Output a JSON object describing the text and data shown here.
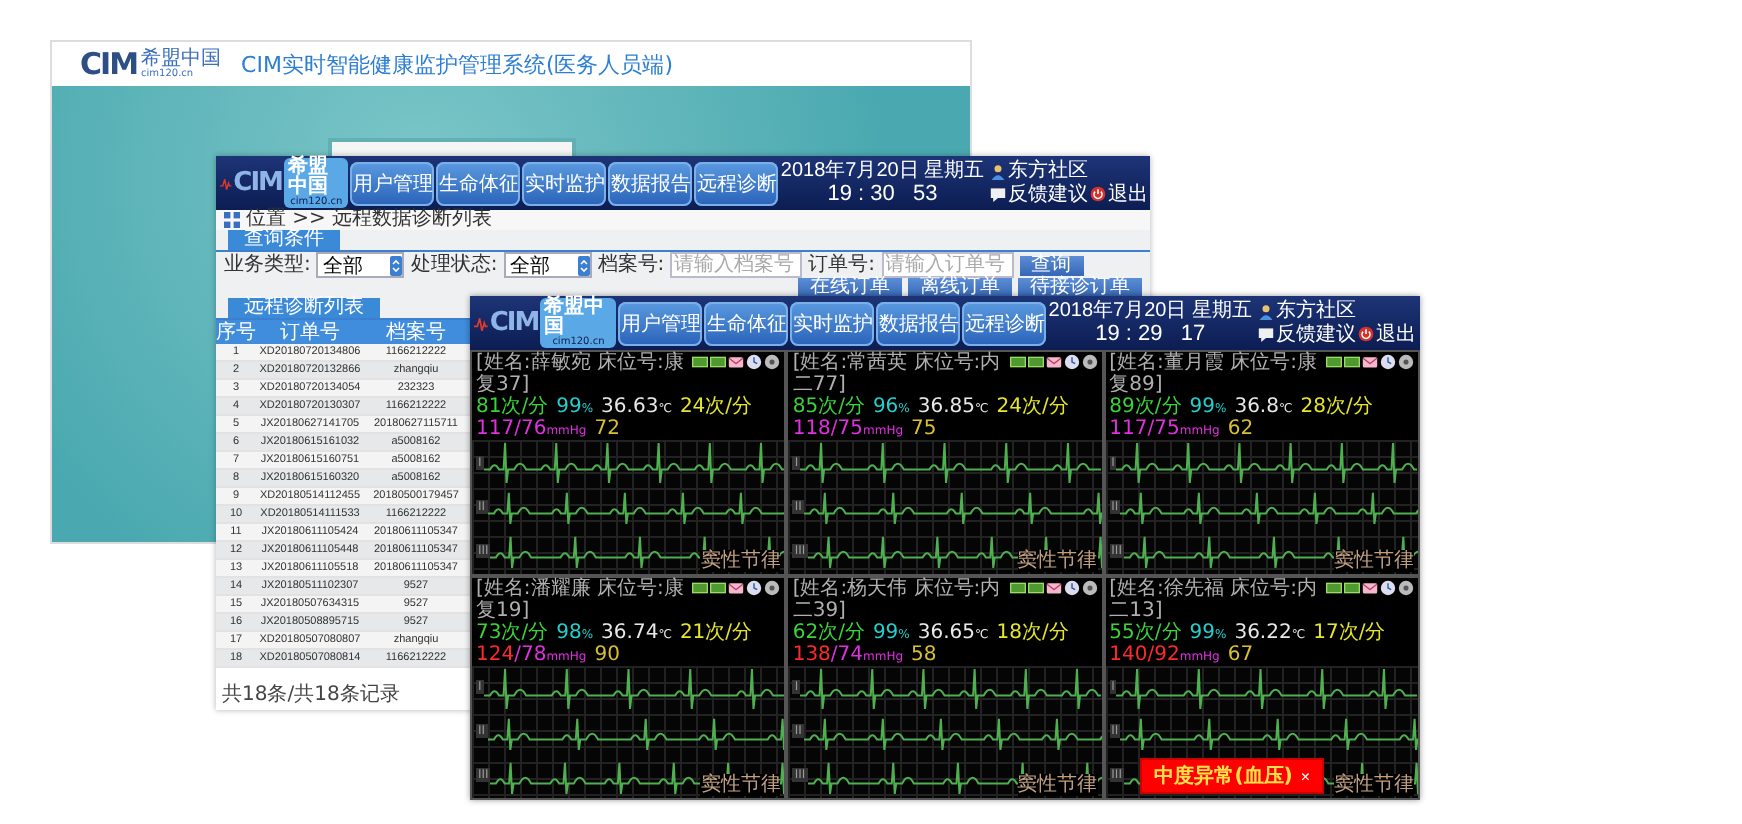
{
  "login_window": {
    "logo": {
      "mark": "CIM",
      "name": "希盟中国",
      "site": "cim120.cn"
    },
    "title": "CIM实时智能健康监护管理系统(医务人员端)"
  },
  "list_window": {
    "header": {
      "logo": {
        "mark": "CIM",
        "name": "希盟中国",
        "site": "cim120.cn"
      },
      "menu": [
        "用户管理",
        "生命体征",
        "实时监护",
        "数据报告",
        "远程诊断"
      ],
      "date": "2018年7月20日 星期五",
      "time": "19 : 30   53",
      "user": "东方社区",
      "feedback": "反馈建议",
      "logout": "退出"
    },
    "breadcrumb": "位置 >> 远程数据诊断列表",
    "filter_tab": "查询条件",
    "filters": [
      {
        "kind": "select",
        "label": "业务类型:",
        "value": "全部"
      },
      {
        "kind": "select",
        "label": "处理状态:",
        "value": "全部"
      },
      {
        "kind": "input",
        "label": "档案号:",
        "placeholder": "请输入档案号"
      },
      {
        "kind": "input",
        "label": "订单号:",
        "placeholder": "请输入订单号"
      }
    ],
    "search_button": "查询",
    "order_buttons": [
      "在线订单",
      "离线订单",
      "待接诊订单"
    ],
    "list_tab": "远程诊断列表",
    "table": {
      "columns": [
        "序号",
        "订单号",
        "档案号"
      ],
      "rows": [
        [
          "1",
          "XD20180720134806",
          "1166212222"
        ],
        [
          "2",
          "XD20180720132866",
          "zhangqiu"
        ],
        [
          "3",
          "XD20180720134054",
          "232323"
        ],
        [
          "4",
          "XD20180720130307",
          "1166212222"
        ],
        [
          "5",
          "JX20180627141705",
          "20180627115711"
        ],
        [
          "6",
          "JX20180615161032",
          "a5008162"
        ],
        [
          "7",
          "JX20180615160751",
          "a5008162"
        ],
        [
          "8",
          "JX20180615160320",
          "a5008162"
        ],
        [
          "9",
          "XD20180514112455",
          "20180500179457"
        ],
        [
          "10",
          "XD20180514111533",
          "1166212222"
        ],
        [
          "11",
          "JX20180611105424",
          "20180611105347"
        ],
        [
          "12",
          "JX20180611105448",
          "20180611105347"
        ],
        [
          "13",
          "JX20180611105518",
          "20180611105347"
        ],
        [
          "14",
          "JX20180511102307",
          "9527"
        ],
        [
          "15",
          "JX20180507634315",
          "9527"
        ],
        [
          "16",
          "JX20180508895715",
          "9527"
        ],
        [
          "17",
          "XD20180507080807",
          "zhangqiu"
        ],
        [
          "18",
          "XD20180507080814",
          "1166212222"
        ]
      ]
    },
    "footer": "共18条/共18条记录"
  },
  "monitor_window": {
    "header": {
      "logo": {
        "mark": "CIM",
        "name": "希盟中国",
        "site": "cim120.cn"
      },
      "menu": [
        "用户管理",
        "生命体征",
        "实时监护",
        "数据报告",
        "远程诊断"
      ],
      "date": "2018年7月20日 星期五",
      "time": "19 : 29   17",
      "user": "东方社区",
      "feedback": "反馈建议",
      "logout": "退出"
    },
    "panels": [
      {
        "patient": "[姓名:薛敏宛 床位号:康复37]",
        "vitals": [
          {
            "kind": "hr",
            "value": "81",
            "unit": "次/分"
          },
          {
            "kind": "spo2",
            "value": "99",
            "unit": "%"
          },
          {
            "kind": "temp",
            "value": "36.63",
            "unit": "℃"
          },
          {
            "kind": "resp",
            "value": "24",
            "unit": "次/分"
          },
          {
            "kind": "bp",
            "systolic": "117",
            "separator": "/",
            "diastolic": "76",
            "unit": "mmHg",
            "systolic_alarm": false,
            "diastolic_alarm": false
          },
          {
            "kind": "pr",
            "value": "72"
          }
        ],
        "leads": [
          "I",
          "II",
          "III"
        ],
        "rhythm": "窦性节律"
      },
      {
        "patient": "[姓名:常茜英 床位号:内二77]",
        "vitals": [
          {
            "kind": "hr",
            "value": "85",
            "unit": "次/分"
          },
          {
            "kind": "spo2",
            "value": "96",
            "unit": "%"
          },
          {
            "kind": "temp",
            "value": "36.85",
            "unit": "℃"
          },
          {
            "kind": "resp",
            "value": "24",
            "unit": "次/分"
          },
          {
            "kind": "bp",
            "systolic": "118",
            "separator": "/",
            "diastolic": "75",
            "unit": "mmHg",
            "systolic_alarm": false,
            "diastolic_alarm": false
          },
          {
            "kind": "pr",
            "value": "75"
          }
        ],
        "leads": [
          "I",
          "II",
          "III"
        ],
        "rhythm": "窦性节律"
      },
      {
        "patient": "[姓名:董月霞 床位号:康复89]",
        "vitals": [
          {
            "kind": "hr",
            "value": "89",
            "unit": "次/分"
          },
          {
            "kind": "spo2",
            "value": "99",
            "unit": "%"
          },
          {
            "kind": "temp",
            "value": "36.8",
            "unit": "℃"
          },
          {
            "kind": "resp",
            "value": "28",
            "unit": "次/分"
          },
          {
            "kind": "bp",
            "systolic": "117",
            "separator": "/",
            "diastolic": "75",
            "unit": "mmHg",
            "systolic_alarm": false,
            "diastolic_alarm": false
          },
          {
            "kind": "pr",
            "value": "62"
          }
        ],
        "leads": [
          "I",
          "II",
          "III"
        ],
        "rhythm": "窦性节律"
      },
      {
        "patient": "[姓名:潘耀廉 床位号:康复19]",
        "vitals": [
          {
            "kind": "hr",
            "value": "73",
            "unit": "次/分"
          },
          {
            "kind": "spo2",
            "value": "98",
            "unit": "%"
          },
          {
            "kind": "temp",
            "value": "36.74",
            "unit": "℃"
          },
          {
            "kind": "resp",
            "value": "21",
            "unit": "次/分"
          },
          {
            "kind": "bp",
            "systolic": "124",
            "separator": "/",
            "diastolic": "78",
            "unit": "mmHg",
            "systolic_alarm": true,
            "diastolic_alarm": false
          },
          {
            "kind": "pr",
            "value": "90"
          }
        ],
        "leads": [
          "I",
          "II",
          "III"
        ],
        "rhythm": "窦性节律"
      },
      {
        "patient": "[姓名:杨天伟 床位号:内二39]",
        "vitals": [
          {
            "kind": "hr",
            "value": "62",
            "unit": "次/分"
          },
          {
            "kind": "spo2",
            "value": "99",
            "unit": "%"
          },
          {
            "kind": "temp",
            "value": "36.65",
            "unit": "℃"
          },
          {
            "kind": "resp",
            "value": "18",
            "unit": "次/分"
          },
          {
            "kind": "bp",
            "systolic": "138",
            "separator": "/",
            "diastolic": "74",
            "unit": "mmHg",
            "systolic_alarm": true,
            "diastolic_alarm": false
          },
          {
            "kind": "pr",
            "value": "58"
          }
        ],
        "leads": [
          "I",
          "II",
          "III"
        ],
        "rhythm": "窦性节律"
      },
      {
        "patient": "[姓名:徐先福 床位号:内二13]",
        "vitals": [
          {
            "kind": "hr",
            "value": "55",
            "unit": "次/分"
          },
          {
            "kind": "spo2",
            "value": "99",
            "unit": "%"
          },
          {
            "kind": "temp",
            "value": "36.22",
            "unit": "℃"
          },
          {
            "kind": "resp",
            "value": "17",
            "unit": "次/分"
          },
          {
            "kind": "bp",
            "systolic": "140",
            "separator": "/",
            "diastolic": "92",
            "unit": "mmHg",
            "systolic_alarm": true,
            "diastolic_alarm": true
          },
          {
            "kind": "pr",
            "value": "67"
          }
        ],
        "leads": [
          "I",
          "II",
          "III"
        ],
        "rhythm": "窦性节律"
      }
    ],
    "alert": {
      "text": "中度异常(血压)",
      "close": "×"
    }
  }
}
